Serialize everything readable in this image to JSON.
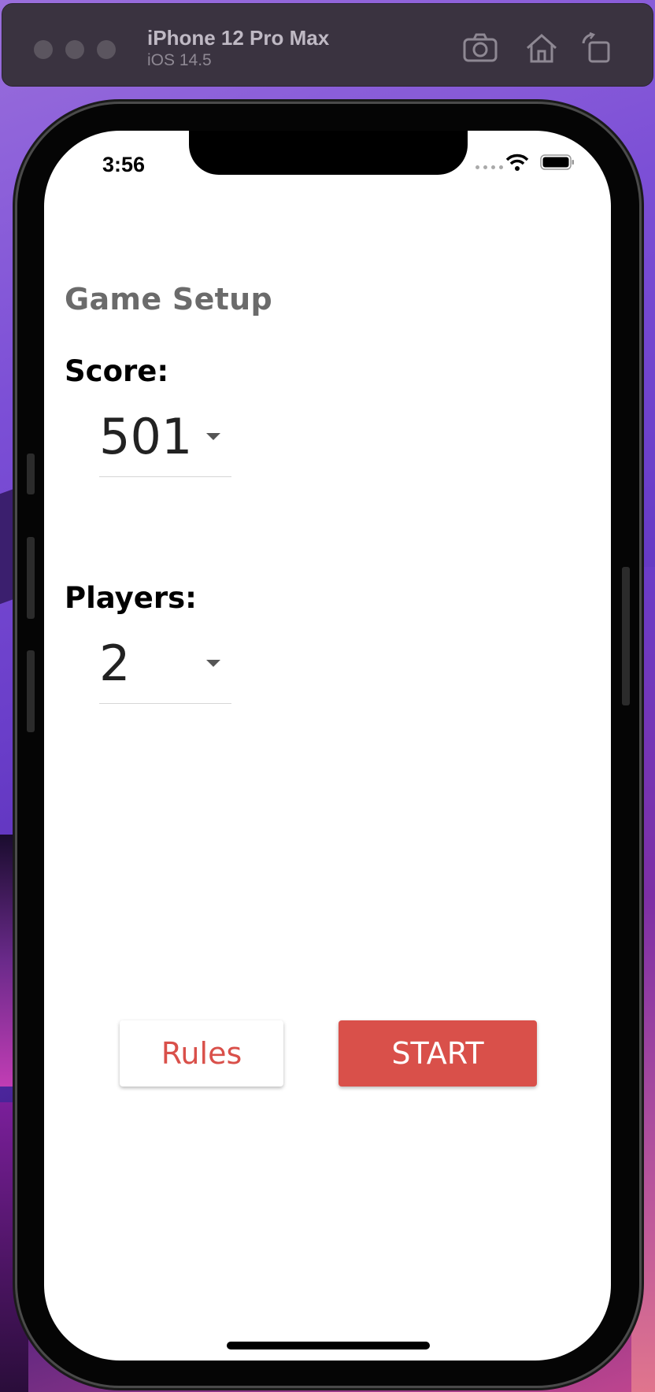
{
  "simulator": {
    "device_name": "iPhone 12 Pro Max",
    "os_version": "iOS 14.5",
    "toolbar_icons": [
      "screenshot-icon",
      "home-icon",
      "rotate-icon"
    ]
  },
  "status_bar": {
    "time": "3:56",
    "icons": [
      "signal-dots-icon",
      "wifi-icon",
      "battery-icon"
    ]
  },
  "page": {
    "title": "Game Setup",
    "score_label": "Score:",
    "score_value": "501",
    "players_label": "Players:",
    "players_value": "2"
  },
  "buttons": {
    "rules_label": "Rules",
    "start_label": "START"
  },
  "colors": {
    "accent": "#d9504a",
    "title_gray": "#6b6b6b",
    "simulator_bar": "#3a3340"
  }
}
